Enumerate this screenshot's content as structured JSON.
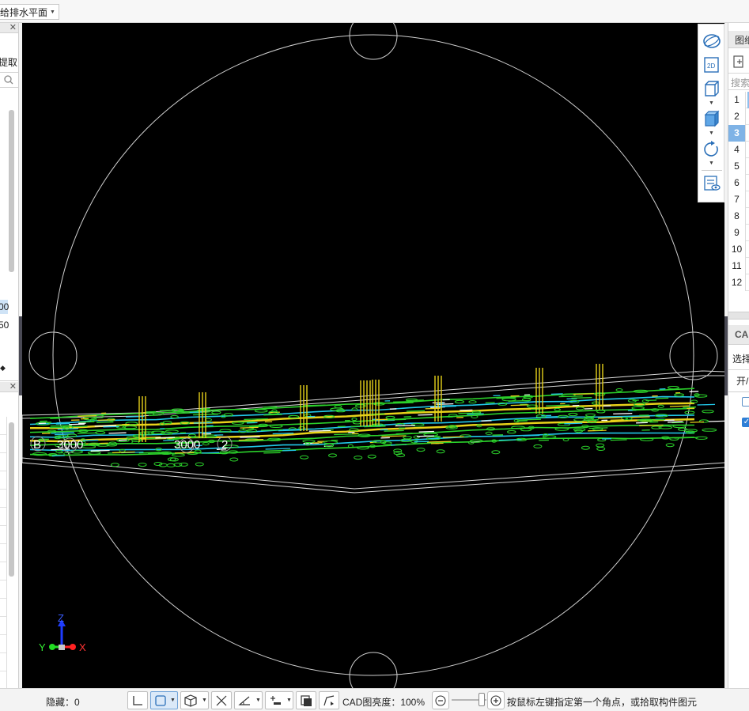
{
  "toolbar": {
    "layer_dropdown": "给排水平面"
  },
  "left_panel": {
    "fragment_pick": "提取",
    "value_a": "00",
    "value_b": "50"
  },
  "viewport": {
    "axis_label_b": "B",
    "dim_left": "3000",
    "dim_mid": "3000",
    "axis_label_2": "2",
    "triad": {
      "z": "Z",
      "y": "Y",
      "x": "X"
    }
  },
  "view_tools": [
    {
      "name": "dynamic-observe",
      "icon": "orbit-icon"
    },
    {
      "name": "2d-view",
      "icon": "2d-icon"
    },
    {
      "name": "3d-view",
      "icon": "cube-outline-icon"
    },
    {
      "name": "shaded-view",
      "icon": "cube-solid-icon"
    },
    {
      "name": "rotate",
      "icon": "rotate-icon"
    },
    {
      "name": "display-settings",
      "icon": "list-eye-icon"
    }
  ],
  "right_panel": {
    "header": "图纸管理",
    "search_placeholder": "搜索",
    "rows": [
      "1",
      "2",
      "3",
      "4",
      "5",
      "6",
      "7",
      "8",
      "9",
      "10",
      "11",
      "12"
    ],
    "selected_row": "3",
    "cad_header": "CAD",
    "select_label": "选择",
    "toggle_label": "开/关"
  },
  "statusbar": {
    "hidden_count": "隐藏：0",
    "cad_brightness": "CAD图亮度：100%",
    "brightness_percent": 100,
    "hint": "按鼠标左键指定第一个角点，或拾取构件图元"
  },
  "colors": {
    "viewport_bg": "#000000",
    "pipe_green": "#2bd12b",
    "pipe_cyan": "#22c8e8",
    "pipe_yellow": "#e8d21a",
    "accent": "#2f7fd6"
  }
}
